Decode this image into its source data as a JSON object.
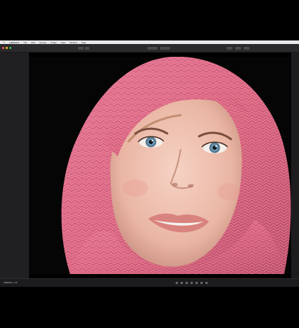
{
  "menubar": {
    "app_name": "Luminar 4",
    "items": [
      "File",
      "Edit",
      "Canvas",
      "Image",
      "View",
      "Window",
      "Help"
    ]
  },
  "statusbar": {
    "filename": "IMG0054.tif"
  },
  "colors": {
    "menubar_bg": "#e9e9eb",
    "toolbar_bg": "#2a2a2c",
    "sidebar_bg": "#202022",
    "viewer_bg": "#050505",
    "scarf_pink": "#e0718d",
    "accent_close": "#ff5f57",
    "accent_min": "#febc2e",
    "accent_max": "#28c840"
  },
  "icons": [
    "apple-icon",
    "window-close-icon",
    "window-minimize-icon",
    "window-maximize-icon"
  ]
}
